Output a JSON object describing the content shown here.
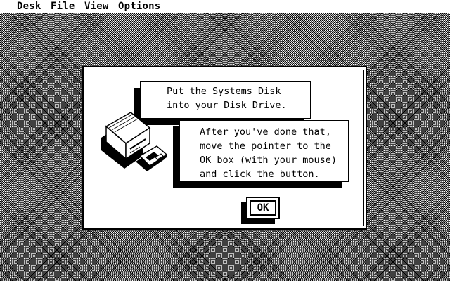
{
  "menubar": {
    "items": [
      {
        "label": "Desk"
      },
      {
        "label": "File"
      },
      {
        "label": "View"
      },
      {
        "label": "Options"
      }
    ]
  },
  "dialog": {
    "message1": [
      "Put the Systems Disk",
      "into your Disk Drive."
    ],
    "message2": [
      "After you've done that,",
      "move the pointer to the",
      "OK box (with your mouse)",
      "and click the button."
    ],
    "ok_label": "OK",
    "graphic_icon": "disk-drive-icon",
    "floppy_icon": "floppy-disk-icon"
  }
}
